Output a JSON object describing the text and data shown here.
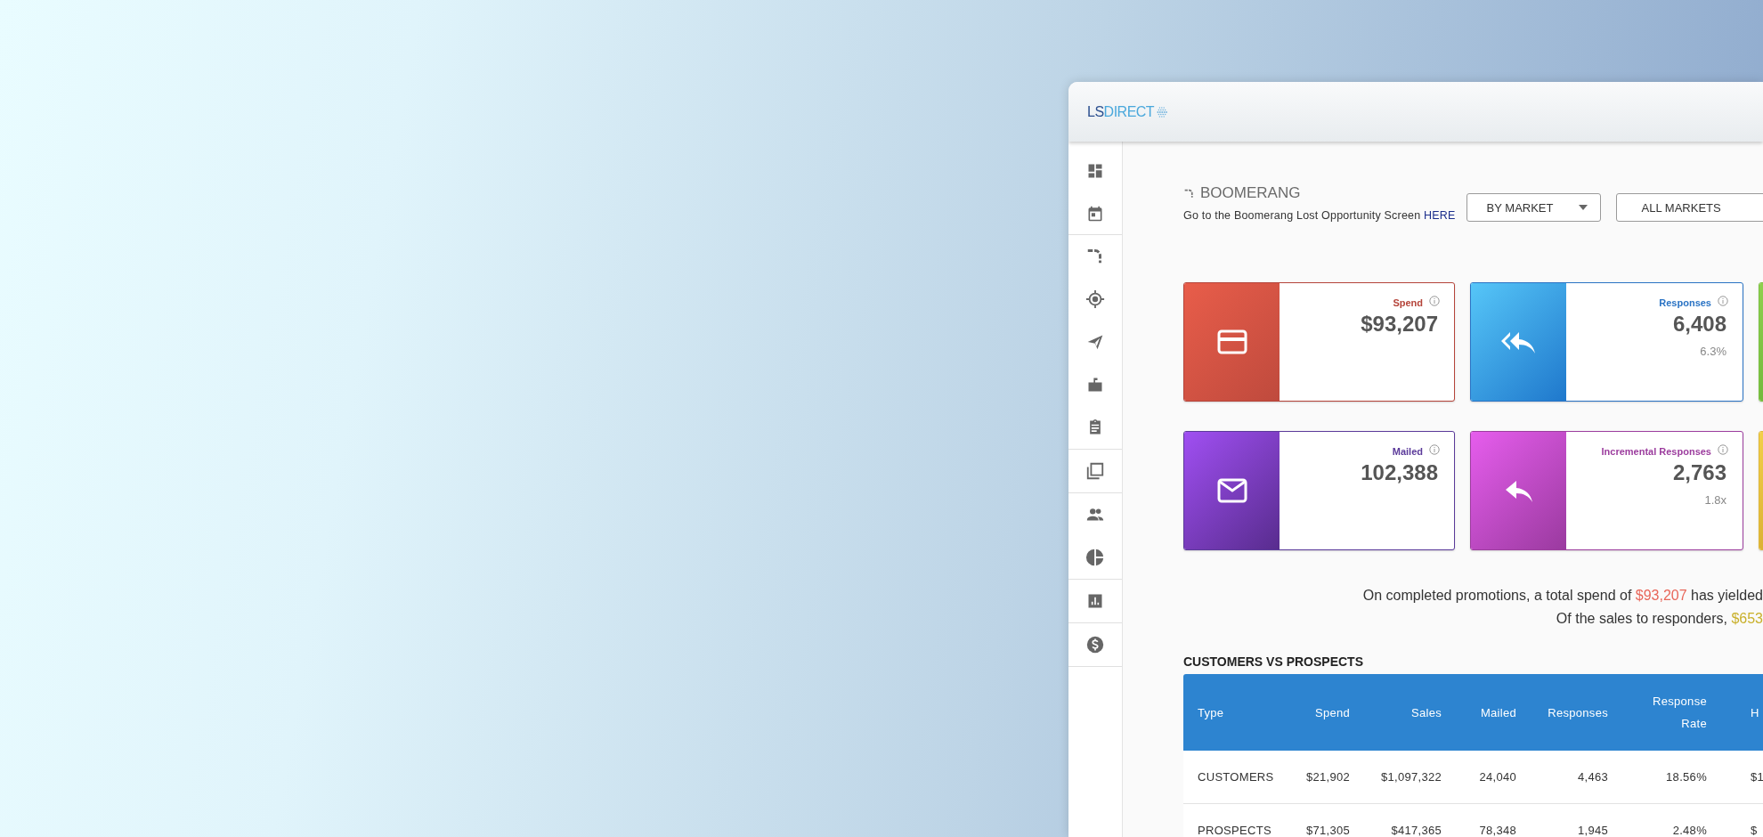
{
  "logo": {
    "prefix": "LS",
    "suffix": "DIRECT"
  },
  "page": {
    "title": "BOOMERANG",
    "subtitle": "Go to the Boomerang Lost Opportunity Screen",
    "link": "HERE"
  },
  "filters": [
    {
      "label": "BY MARKET",
      "kind": "dropdown"
    },
    {
      "label": "ALL MARKETS",
      "kind": "plain"
    }
  ],
  "cards": [
    {
      "kind": "spend",
      "label": "Spend",
      "value": "$93,207",
      "color": "#b5443a"
    },
    {
      "kind": "responses",
      "label": "Responses",
      "value": "6,408",
      "sub": "6.3%",
      "color": "#2a73c4"
    },
    {
      "kind": "green",
      "color": "#7cc242"
    },
    {
      "kind": "mailed",
      "label": "Mailed",
      "value": "102,388",
      "color": "#5b3a9a"
    },
    {
      "kind": "incremental",
      "label": "Incremental Responses",
      "value": "2,763",
      "sub": "1.8x",
      "color": "#9c3d9e"
    },
    {
      "kind": "yellow",
      "color": "#e0b83a"
    }
  ],
  "summary": [
    {
      "before": "On completed promotions, a total spend of ",
      "amount": "$93,207",
      "after": " has yielded",
      "color": "#e8675a"
    },
    {
      "before": "Of the sales to responders, ",
      "amount": "$653",
      "color": "#c9b02a"
    }
  ],
  "table": {
    "title": "CUSTOMERS VS PROSPECTS",
    "columns": [
      "Type",
      "Spend",
      "Sales",
      "Mailed",
      "Responses",
      "Response Rate",
      "H"
    ],
    "rows": [
      [
        "CUSTOMERS",
        "$21,902",
        "$1,097,322",
        "24,040",
        "4,463",
        "18.56%",
        "$1"
      ],
      [
        "PROSPECTS",
        "$71,305",
        "$417,365",
        "78,348",
        "1,945",
        "2.48%",
        "$"
      ]
    ]
  }
}
